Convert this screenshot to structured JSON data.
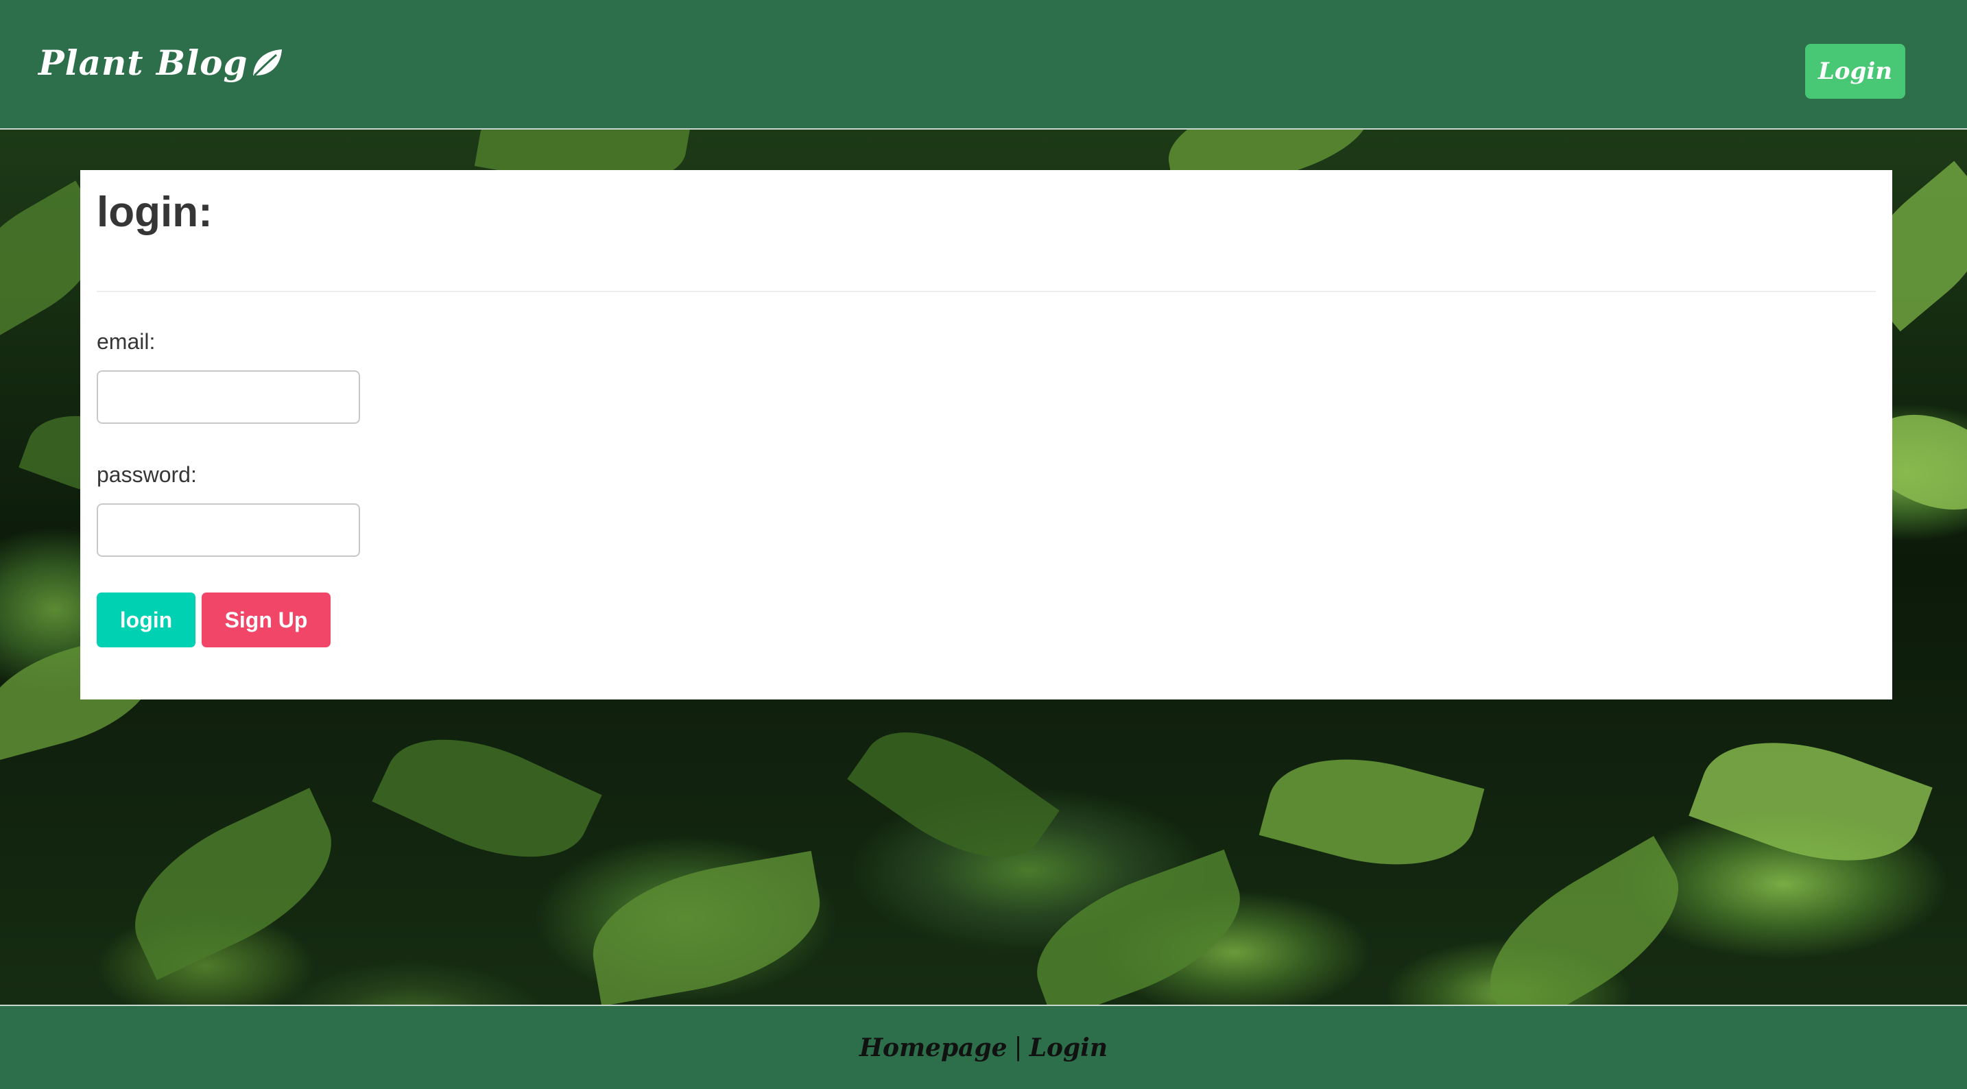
{
  "header": {
    "brand": "Plant Blog",
    "brand_icon": "leaf-icon",
    "login_button": "Login"
  },
  "form": {
    "title": "login:",
    "email_label": "email:",
    "email_value": "",
    "password_label": "password:",
    "password_value": "",
    "login_button": "login",
    "signup_button": "Sign Up"
  },
  "footer": {
    "homepage_link": "Homepage",
    "separator": "|",
    "login_link": "Login"
  },
  "colors": {
    "nav_background": "#2e6f4b",
    "nav_login_button": "#48c774",
    "login_button": "#00d1b2",
    "signup_button": "#f14668"
  }
}
